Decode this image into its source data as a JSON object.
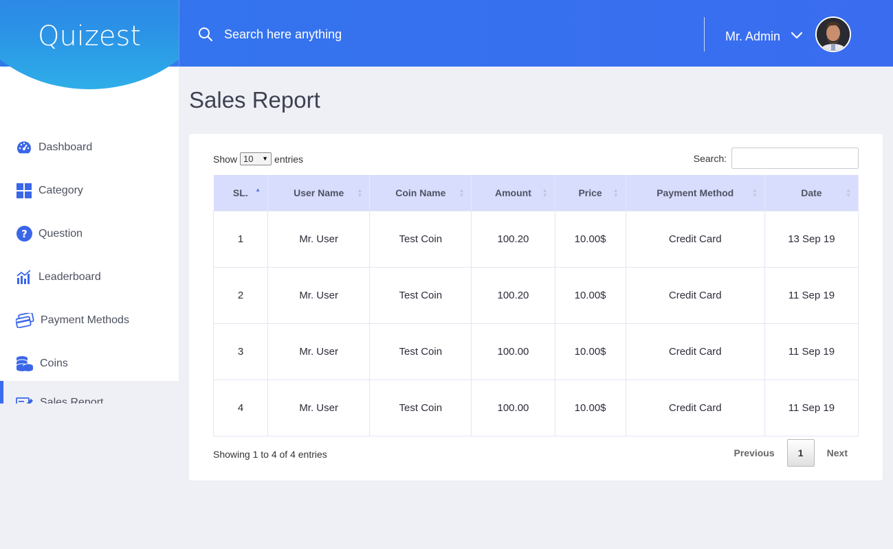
{
  "brand": {
    "name": "Quizest"
  },
  "header": {
    "search_placeholder": "Search here anything",
    "user_name": "Mr. Admin"
  },
  "sidebar": {
    "items": [
      {
        "label": "Dashboard",
        "icon": "dashboard-icon"
      },
      {
        "label": "Category",
        "icon": "category-grid-icon"
      },
      {
        "label": "Question",
        "icon": "question-icon"
      },
      {
        "label": "Leaderboard",
        "icon": "leaderboard-chart-icon"
      },
      {
        "label": "Payment Methods",
        "icon": "credit-cards-icon"
      },
      {
        "label": "Coins",
        "icon": "coins-stack-icon"
      },
      {
        "label": "Sales Report",
        "icon": "report-edit-icon",
        "active": true
      }
    ]
  },
  "page": {
    "title": "Sales Report"
  },
  "table_controls": {
    "show_label": "Show",
    "entries_value": "10",
    "entries_label": "entries",
    "search_label": "Search:"
  },
  "table": {
    "headers": [
      "SL.",
      "User Name",
      "Coin Name",
      "Amount",
      "Price",
      "Payment Method",
      "Date"
    ],
    "rows": [
      [
        "1",
        "Mr. User",
        "Test Coin",
        "100.20",
        "10.00$",
        "Credit Card",
        "13 Sep 19"
      ],
      [
        "2",
        "Mr. User",
        "Test Coin",
        "100.20",
        "10.00$",
        "Credit Card",
        "11 Sep 19"
      ],
      [
        "3",
        "Mr. User",
        "Test Coin",
        "100.00",
        "10.00$",
        "Credit Card",
        "11 Sep 19"
      ],
      [
        "4",
        "Mr. User",
        "Test Coin",
        "100.00",
        "10.00$",
        "Credit Card",
        "11 Sep 19"
      ]
    ]
  },
  "footer": {
    "info": "Showing 1 to 4 of 4 entries",
    "previous": "Previous",
    "page": "1",
    "next": "Next"
  },
  "colors": {
    "accent": "#3a6cf0",
    "header_row": "#d8ddfd",
    "background": "#eff0f5"
  }
}
